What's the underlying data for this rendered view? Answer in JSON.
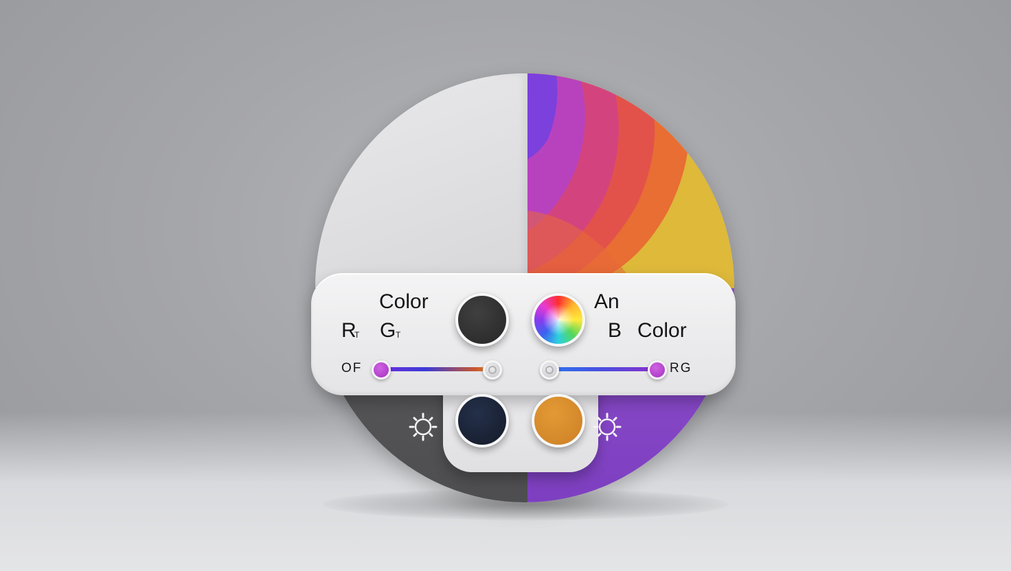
{
  "labels": {
    "color_top_left": "Color",
    "r": "R",
    "r_sub": "T",
    "g": "G",
    "g_sub": "T",
    "an": "An",
    "b": "B",
    "color_right": "Color",
    "of": "OF",
    "rg": "RG"
  },
  "swatches": {
    "top_left": "#333333",
    "top_right": "spectrum",
    "bottom_left": "#1b2233",
    "bottom_right": "#d98a2c"
  },
  "sliders": {
    "left": {
      "value": 0.0,
      "gradient": [
        "#6a2fe0",
        "#3b3bd6",
        "#c9572e",
        "#e08a2c"
      ]
    },
    "right": {
      "value": 1.0,
      "gradient": [
        "#2b74ef",
        "#6a2fe0",
        "#8a2fc9"
      ]
    }
  },
  "colors": {
    "purple_quadrant": "#8a4cc9",
    "dark_quadrant": "#555557",
    "accent_knob": "#bb45d4"
  },
  "icons": {
    "left": "sun-icon",
    "right": "sun-icon"
  }
}
